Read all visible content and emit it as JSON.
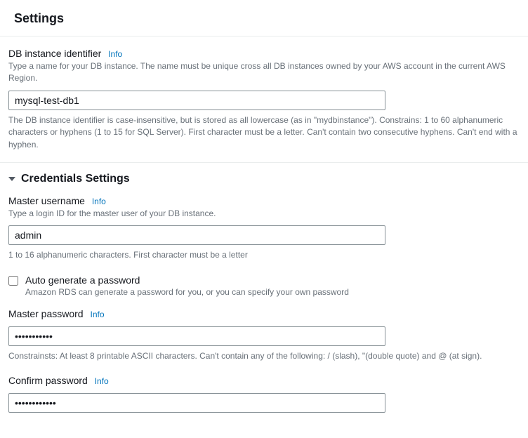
{
  "header": {
    "title": "Settings"
  },
  "db_identifier": {
    "label": "DB instance identifier",
    "info": "Info",
    "description": "Type a name for your DB instance. The name must be unique cross all DB instances owned by your AWS account in the current AWS Region.",
    "value": "mysql-test-db1",
    "hint": "The DB instance identifier is case-insensitive, but is stored as all lowercase (as in \"mydbinstance\"). Constrains: 1 to 60 alphanumeric characters or hyphens (1 to 15 for SQL Server). First character must be a letter. Can't contain two consecutive hyphens. Can't end with a hyphen."
  },
  "credentials": {
    "section_title": "Credentials Settings",
    "master_username": {
      "label": "Master username",
      "info": "Info",
      "description": "Type a login ID for the master user of your DB instance.",
      "value": "admin",
      "hint": "1 to 16 alphanumeric characters. First character must be a letter"
    },
    "auto_generate": {
      "label": "Auto generate a password",
      "description": "Amazon RDS can generate a password for you, or you can specify your own password"
    },
    "master_password": {
      "label": "Master password",
      "info": "Info",
      "value": "•••••••••••",
      "hint": "Constrainsts: At least 8 printable ASCII characters. Can't contain any of the following: / (slash), \"(double quote) and @ (at sign)."
    },
    "confirm_password": {
      "label": "Confirm password",
      "info": "Info",
      "value": "••••••••••••"
    }
  }
}
